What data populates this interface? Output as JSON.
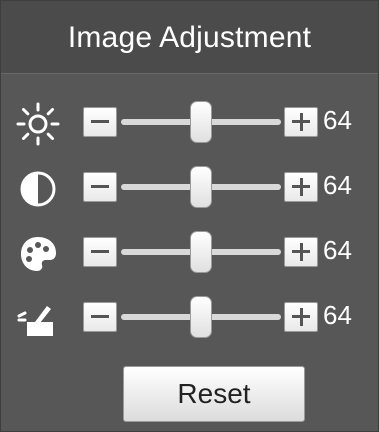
{
  "panel": {
    "title": "Image Adjustment",
    "reset_label": "Reset"
  },
  "controls": [
    {
      "name": "brightness",
      "icon": "brightness-icon",
      "value": "64",
      "level": 0.5
    },
    {
      "name": "contrast",
      "icon": "contrast-icon",
      "value": "64",
      "level": 0.5
    },
    {
      "name": "saturation",
      "icon": "palette-icon",
      "value": "64",
      "level": 0.5
    },
    {
      "name": "sharpness",
      "icon": "sharpness-icon",
      "value": "64",
      "level": 0.5
    }
  ],
  "colors": {
    "panel_bg": "#575757",
    "header_bg": "#4b4b4b",
    "text": "#ffffff"
  }
}
